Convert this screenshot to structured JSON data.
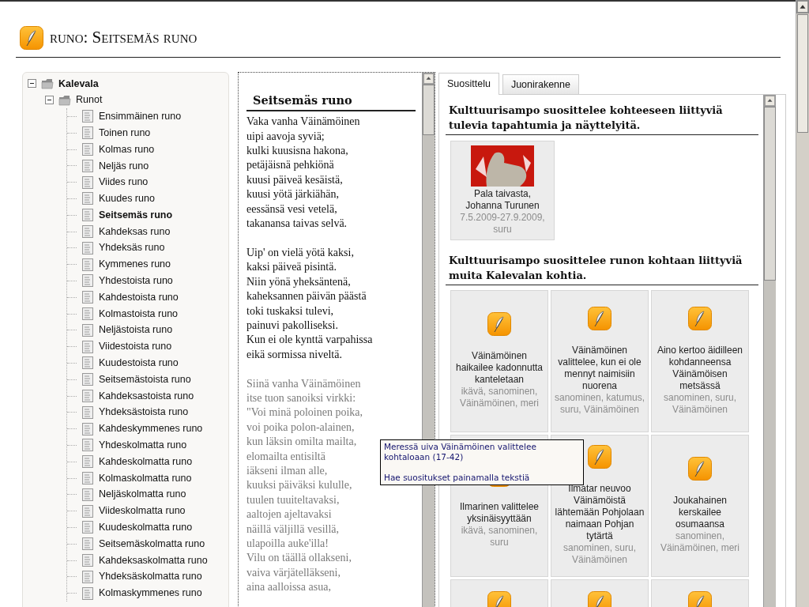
{
  "page_title": "runo: Seitsemäs runo",
  "tree": [
    {
      "label": "Kalevala",
      "kind": "folder",
      "expanded": true,
      "children": [
        {
          "label": "Runot",
          "kind": "folder",
          "expanded": true,
          "children": [
            {
              "label": "Ensimmäinen runo",
              "kind": "doc",
              "selected": false
            },
            {
              "label": "Toinen runo",
              "kind": "doc",
              "selected": false
            },
            {
              "label": "Kolmas runo",
              "kind": "doc",
              "selected": false
            },
            {
              "label": "Neljäs runo",
              "kind": "doc",
              "selected": false
            },
            {
              "label": "Viides runo",
              "kind": "doc",
              "selected": false
            },
            {
              "label": "Kuudes runo",
              "kind": "doc",
              "selected": false
            },
            {
              "label": "Seitsemäs runo",
              "kind": "doc",
              "selected": true
            },
            {
              "label": "Kahdeksas runo",
              "kind": "doc",
              "selected": false
            },
            {
              "label": "Yhdeksäs runo",
              "kind": "doc",
              "selected": false
            },
            {
              "label": "Kymmenes runo",
              "kind": "doc",
              "selected": false
            },
            {
              "label": "Yhdestoista runo",
              "kind": "doc",
              "selected": false
            },
            {
              "label": "Kahdestoista runo",
              "kind": "doc",
              "selected": false
            },
            {
              "label": "Kolmastoista runo",
              "kind": "doc",
              "selected": false
            },
            {
              "label": "Neljästoista runo",
              "kind": "doc",
              "selected": false
            },
            {
              "label": "Viidestoista runo",
              "kind": "doc",
              "selected": false
            },
            {
              "label": "Kuudestoista runo",
              "kind": "doc",
              "selected": false
            },
            {
              "label": "Seitsemästoista runo",
              "kind": "doc",
              "selected": false
            },
            {
              "label": "Kahdeksastoista runo",
              "kind": "doc",
              "selected": false
            },
            {
              "label": "Yhdeksästoista runo",
              "kind": "doc",
              "selected": false
            },
            {
              "label": "Kahdeskymmenes runo",
              "kind": "doc",
              "selected": false
            },
            {
              "label": "Yhdeskolmatta runo",
              "kind": "doc",
              "selected": false
            },
            {
              "label": "Kahdeskolmatta runo",
              "kind": "doc",
              "selected": false
            },
            {
              "label": "Kolmaskolmatta runo",
              "kind": "doc",
              "selected": false
            },
            {
              "label": "Neljäskolmatta runo",
              "kind": "doc",
              "selected": false
            },
            {
              "label": "Viideskolmatta runo",
              "kind": "doc",
              "selected": false
            },
            {
              "label": "Kuudeskolmatta runo",
              "kind": "doc",
              "selected": false
            },
            {
              "label": "Seitsemäskolmatta runo",
              "kind": "doc",
              "selected": false
            },
            {
              "label": "Kahdeksaskolmatta runo",
              "kind": "doc",
              "selected": false
            },
            {
              "label": "Yhdeksäskolmatta runo",
              "kind": "doc",
              "selected": false
            },
            {
              "label": "Kolmaskymmenes runo",
              "kind": "doc",
              "selected": false
            }
          ]
        }
      ]
    }
  ],
  "poem": {
    "title": "Seitsemäs runo",
    "stanzas": [
      {
        "dimmed": false,
        "lines": [
          "Vaka vanha Väinämöinen",
          "uipi aavoja syviä;",
          "kulki kuusisna hakona,",
          "petäjäisnä pehkiönä",
          "kuusi päiveä kesäistä,",
          "kuusi yötä järkiähän,",
          "eessänsä vesi vetelä,",
          "takanansa taivas selvä."
        ]
      },
      {
        "dimmed": false,
        "lines": [
          "Uip' on vielä yötä kaksi,",
          "kaksi päiveä pisintä.",
          "Niin yönä yheksäntenä,",
          "kaheksannen päivän päästä",
          "toki tuskaksi tulevi,",
          "painuvi pakolliseksi.",
          "Kun ei ole kynttä varpahissa",
          "eikä sormissa niveltä."
        ]
      },
      {
        "dimmed": true,
        "lines": [
          "Siinä vanha Väinämöinen",
          "itse tuon sanoiksi virkki:",
          "\"Voi minä poloinen poika,",
          "voi poika polon-alainen,",
          "kun läksin omilta mailta,",
          "elomailta entisiltä",
          "iäkseni ilman alle,",
          "kuuksi päiväksi kululle,",
          "tuulen tuuiteltavaksi,",
          "aaltojen ajeltavaksi",
          "näillä väljillä vesillä,",
          "ulapoilla auke'illa!",
          "Vilu on täällä ollakseni,",
          "vaiva värjätelläkseni,",
          "aina aalloissa asua,"
        ]
      }
    ]
  },
  "tabs": [
    {
      "label": "Suosittelu",
      "selected": true
    },
    {
      "label": "Juonirakenne",
      "selected": false
    }
  ],
  "events": {
    "heading": "Kulttuurisampo suosittelee kohteeseen liittyviä tulevia tapahtumia ja näyttelyitä.",
    "items": [
      {
        "title": "Pala taivasta, Johanna Turunen",
        "meta": "7.5.2009-27.9.2009, suru"
      }
    ]
  },
  "passages": {
    "heading": "Kulttuurisampo suosittelee runon kohtaan liittyviä muita Kalevalan kohtia.",
    "items": [
      {
        "kind": "full",
        "title": "Väinämöinen haikailee kadonnutta kanteletaan",
        "tags": "ikävä, sanominen, Väinämöinen, meri"
      },
      {
        "kind": "full",
        "title": "Väinämöinen valittelee, kun ei ole mennyt naimisiin nuorena",
        "tags": "sanominen, katumus, suru, Väinämöinen"
      },
      {
        "kind": "full",
        "title": "Aino kertoo äidilleen kohdanneensa Väinämöisen metsässä",
        "tags": "sanominen, suru, Väinämöinen"
      },
      {
        "kind": "full",
        "title": "Ilmarinen valittelee yksinäisyyttään",
        "tags": "ikävä, sanominen, suru"
      },
      {
        "kind": "full",
        "title": "Ilmatar neuvoo Väinämöistä lähtemään Pohjolaan naimaan Pohjan tytärtä",
        "tags": "sanominen, suru, Väinämöinen"
      },
      {
        "kind": "full",
        "title": "Joukahainen kerskailee osumaansa",
        "tags": "sanominen, Väinämöinen, meri"
      },
      {
        "kind": "cut"
      },
      {
        "kind": "cut"
      },
      {
        "kind": "cut"
      }
    ]
  },
  "tooltip": {
    "lines": [
      "Meressä uiva Väinämöinen valittelee kohtaloaan (17-42)",
      "Hae suositukset painamalla tekstiä"
    ]
  }
}
